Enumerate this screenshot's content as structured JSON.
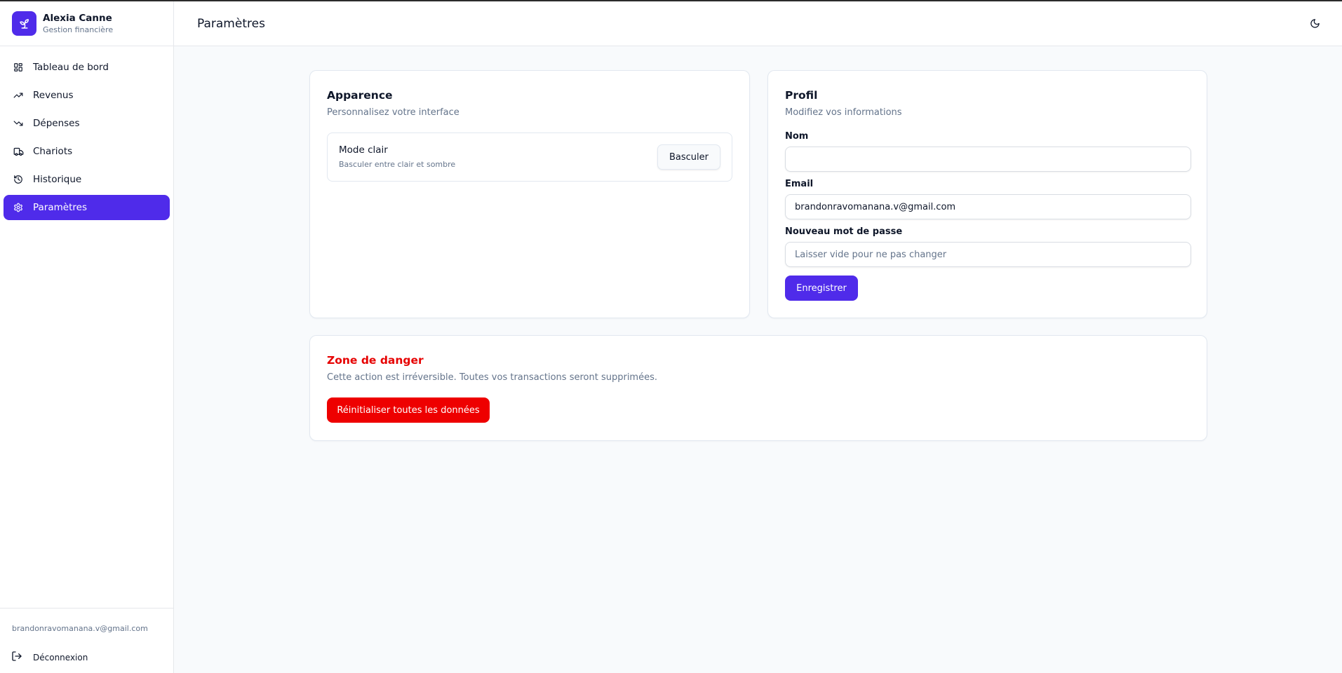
{
  "app": {
    "user_name": "Alexia Canne",
    "subtitle": "Gestion financière",
    "logo_icon": "sprout-icon",
    "accent_color": "#4f2bea",
    "danger_color": "#ee0000"
  },
  "sidebar": {
    "items": [
      {
        "label": "Tableau de bord",
        "icon": "dashboard-grid-icon",
        "active": false
      },
      {
        "label": "Revenus",
        "icon": "trending-up-icon",
        "active": false
      },
      {
        "label": "Dépenses",
        "icon": "trending-down-icon",
        "active": false
      },
      {
        "label": "Chariots",
        "icon": "truck-icon",
        "active": false
      },
      {
        "label": "Historique",
        "icon": "history-icon",
        "active": false
      },
      {
        "label": "Paramètres",
        "icon": "settings-gear-icon",
        "active": true
      }
    ],
    "footer_email": "brandonravomanana.v@gmail.com",
    "logout_label": "Déconnexion"
  },
  "header": {
    "title": "Paramètres",
    "theme_icon": "moon-icon"
  },
  "appearance": {
    "title": "Apparence",
    "subtitle": "Personnalisez votre interface",
    "mode_title": "Mode clair",
    "mode_sub": "Basculer entre clair et sombre",
    "toggle_label": "Basculer"
  },
  "profile": {
    "title": "Profil",
    "subtitle": "Modifiez vos informations",
    "name_label": "Nom",
    "name_value": "",
    "email_label": "Email",
    "email_value": "brandonravomanana.v@gmail.com",
    "password_label": "Nouveau mot de passe",
    "password_placeholder": "Laisser vide pour ne pas changer",
    "save_label": "Enregistrer"
  },
  "danger": {
    "title": "Zone de danger",
    "description": "Cette action est irréversible. Toutes vos transactions seront supprimées.",
    "reset_label": "Réinitialiser toutes les données"
  }
}
